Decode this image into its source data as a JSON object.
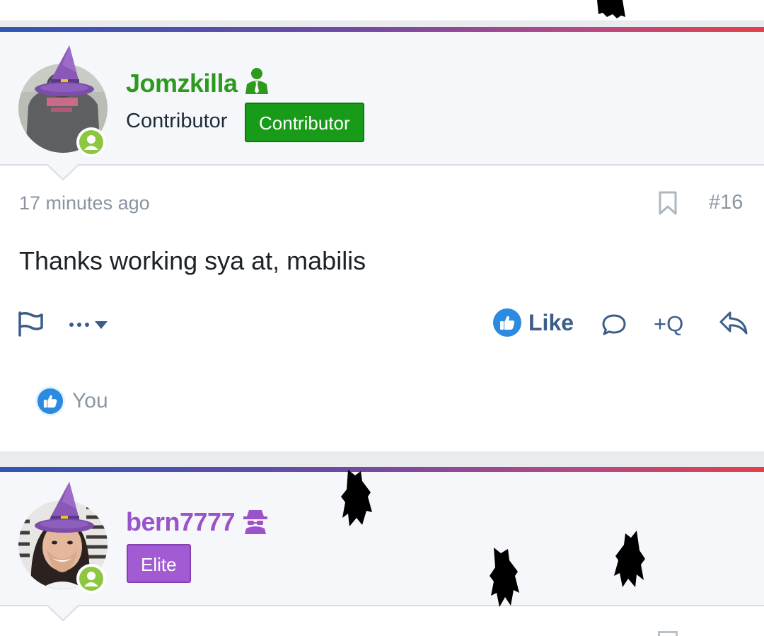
{
  "posts": [
    {
      "username": "Jomzkilla",
      "user_title": "Contributor",
      "badge": "Contributor",
      "time": "17 minutes ago",
      "post_number": "#16",
      "body": "Thanks working sya at, mabilis",
      "actions": {
        "like_label": "Like",
        "quote_label": "+Q"
      },
      "reactions": {
        "users": "You"
      }
    },
    {
      "username": "bern7777",
      "badge": "Elite"
    }
  ],
  "colors": {
    "contributor_green": "#2d9a1f",
    "elite_purple": "#9a53c9",
    "action_blue": "#3b5d8a",
    "like_blue": "#2a8be0",
    "online_green": "#8dc63f"
  },
  "icons": [
    "witch-hat-icon",
    "online-status-icon",
    "contributor-user-icon",
    "elite-spy-icon",
    "bookmark-icon",
    "report-flag-icon",
    "more-dots-icon",
    "like-thumb-icon",
    "comment-icon",
    "reply-icon",
    "bat-icon"
  ]
}
